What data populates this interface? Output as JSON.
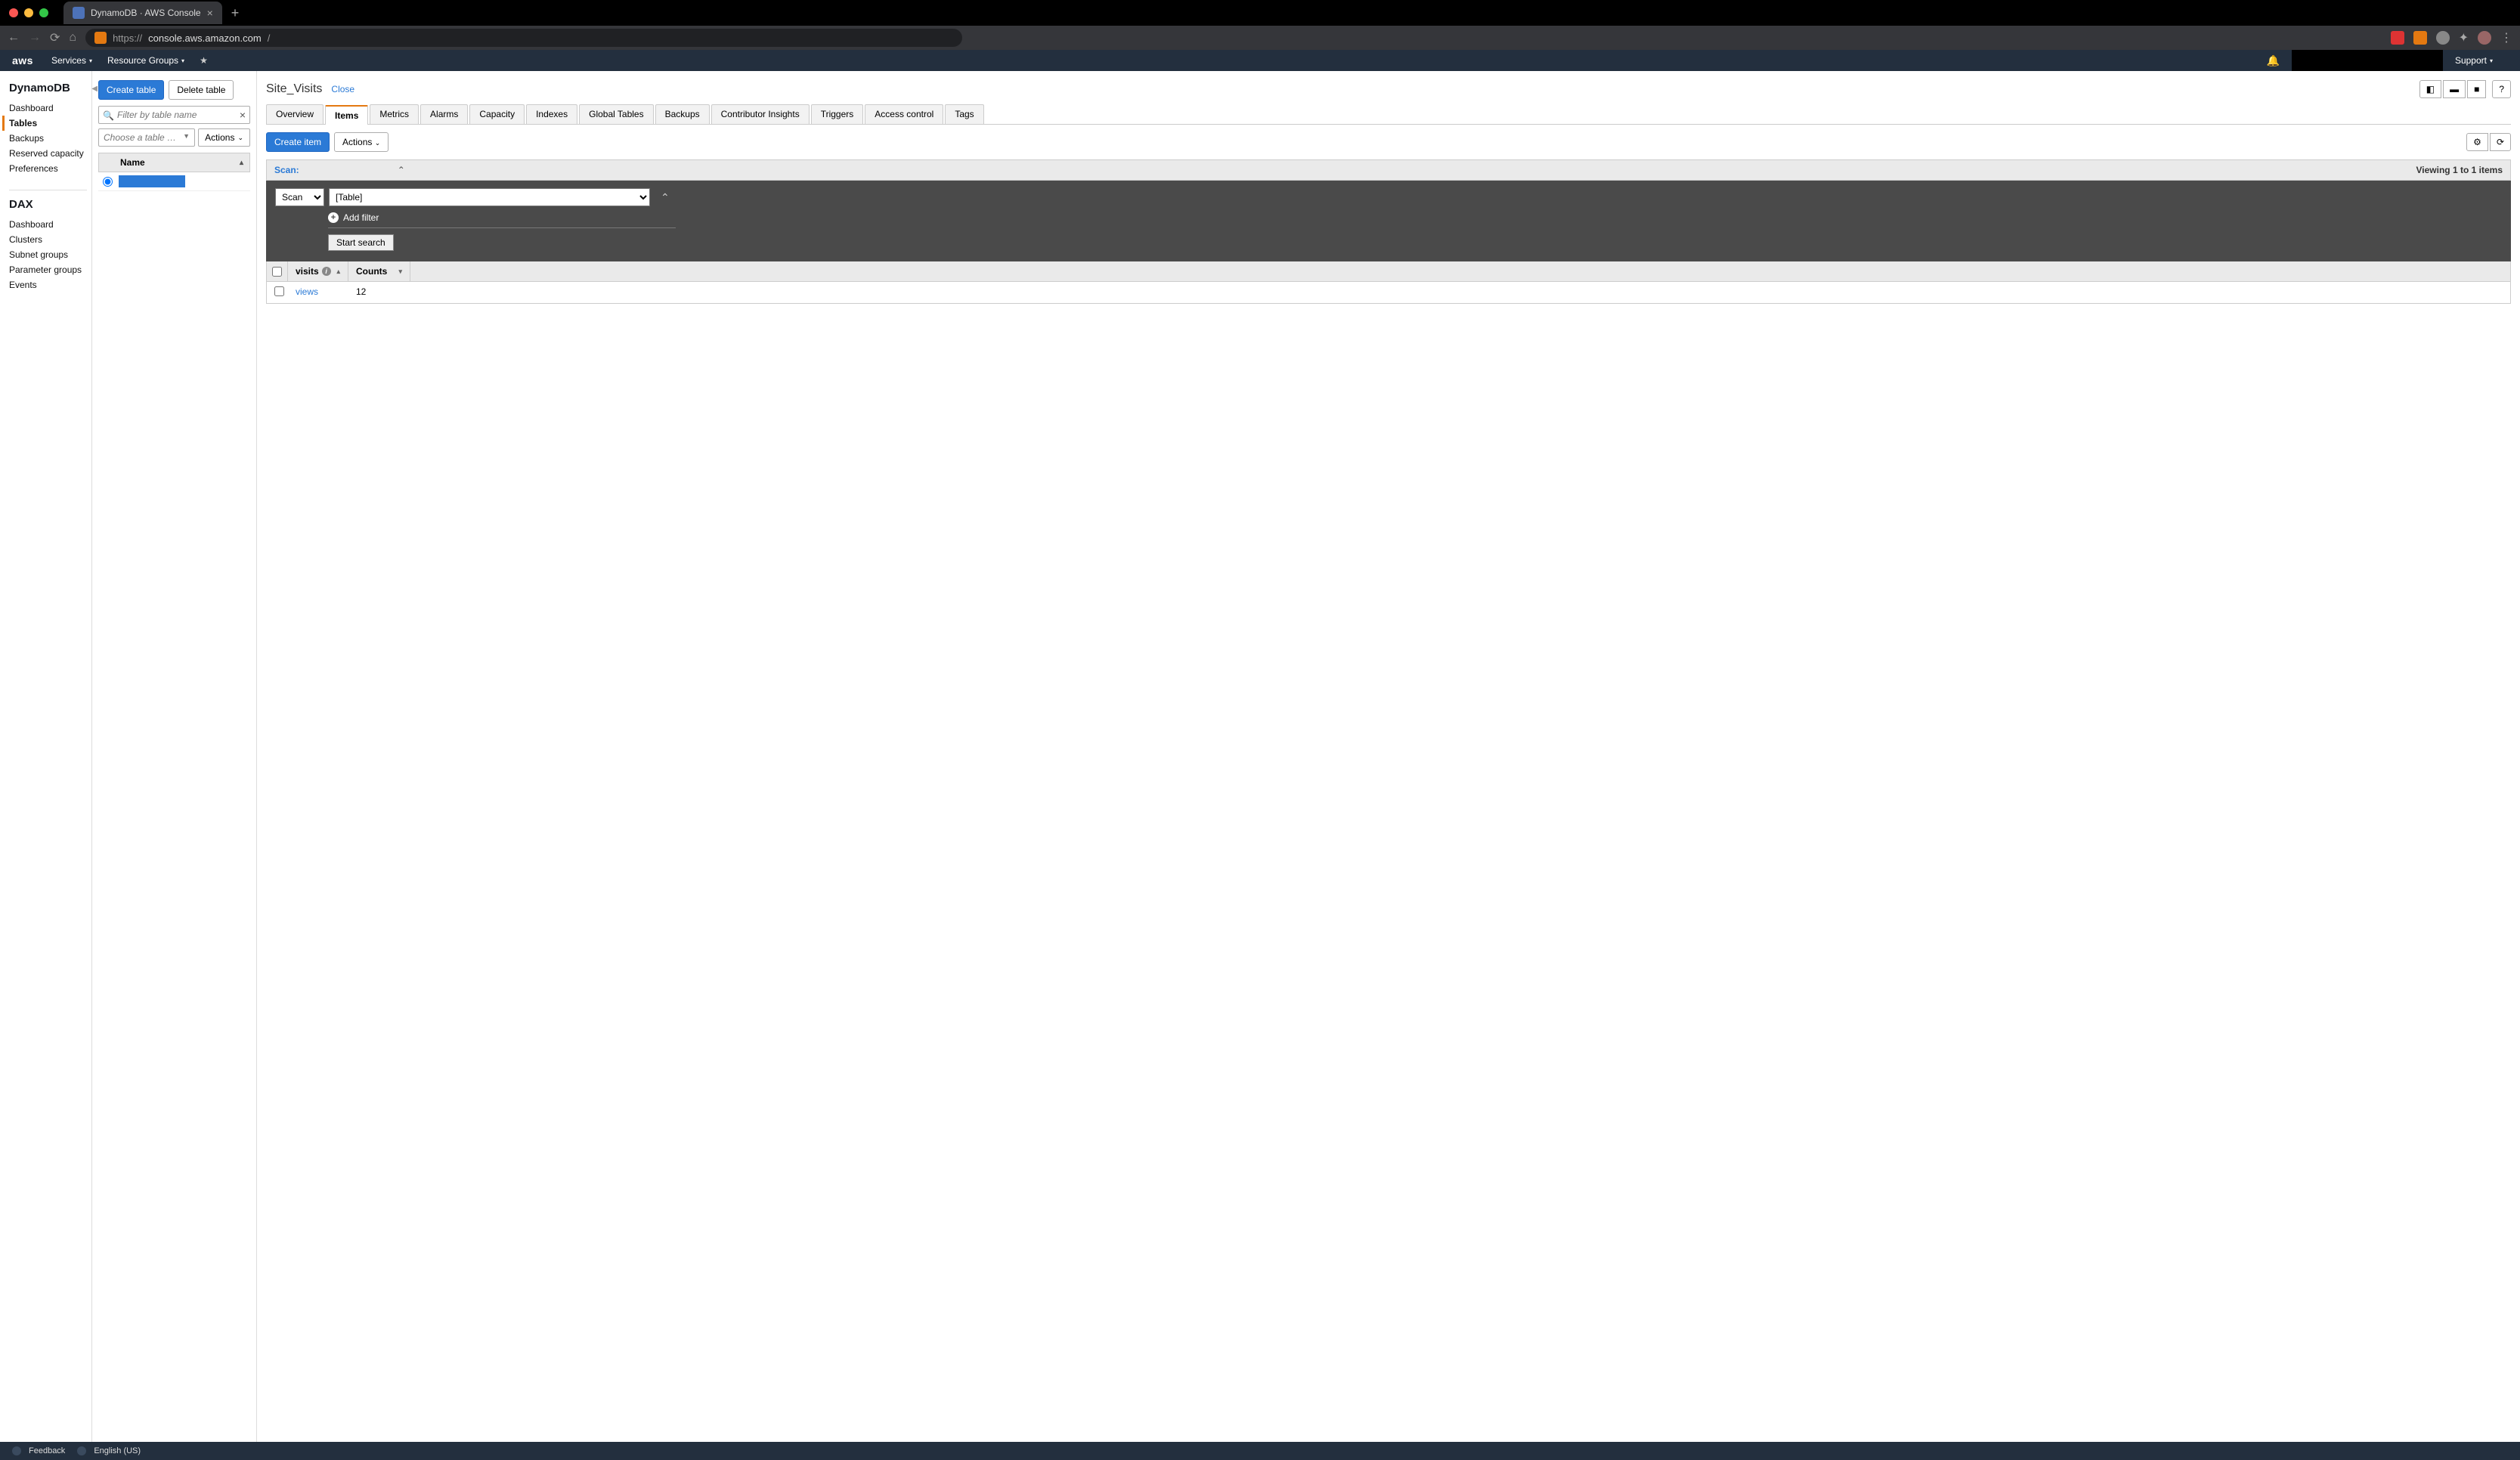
{
  "browser": {
    "tab_title": "DynamoDB · AWS Console",
    "url_scheme": "https://",
    "url_host": "console.aws.amazon.com",
    "url_path": "/"
  },
  "aws_bar": {
    "logo": "aws",
    "menu": [
      "Services",
      "Resource Groups"
    ],
    "support": "Support"
  },
  "left_nav": {
    "title1": "DynamoDB",
    "items1": [
      "Dashboard",
      "Tables",
      "Backups",
      "Reserved capacity",
      "Preferences"
    ],
    "active1": "Tables",
    "title2": "DAX",
    "items2": [
      "Dashboard",
      "Clusters",
      "Subnet groups",
      "Parameter groups",
      "Events"
    ]
  },
  "tables_panel": {
    "create": "Create table",
    "delete": "Delete table",
    "filter_placeholder": "Filter by table name",
    "choose": "Choose a table …",
    "actions": "Actions",
    "col_name": "Name"
  },
  "main": {
    "title": "Site_Visits",
    "close": "Close",
    "tabs": [
      "Overview",
      "Items",
      "Metrics",
      "Alarms",
      "Capacity",
      "Indexes",
      "Global Tables",
      "Backups",
      "Contributor Insights",
      "Triggers",
      "Access control",
      "Tags"
    ],
    "active_tab": "Items",
    "create_item": "Create item",
    "actions": "Actions",
    "scan_label": "Scan:",
    "viewing": "Viewing 1 to 1 items",
    "scan_type": "Scan",
    "scan_table": "[Table]",
    "add_filter": "Add filter",
    "start_search": "Start search",
    "columns": {
      "visits": "visits",
      "counts": "Counts"
    },
    "row": {
      "visits": "views",
      "counts": "12"
    }
  },
  "footer": {
    "feedback": "Feedback",
    "language": "English (US)"
  }
}
